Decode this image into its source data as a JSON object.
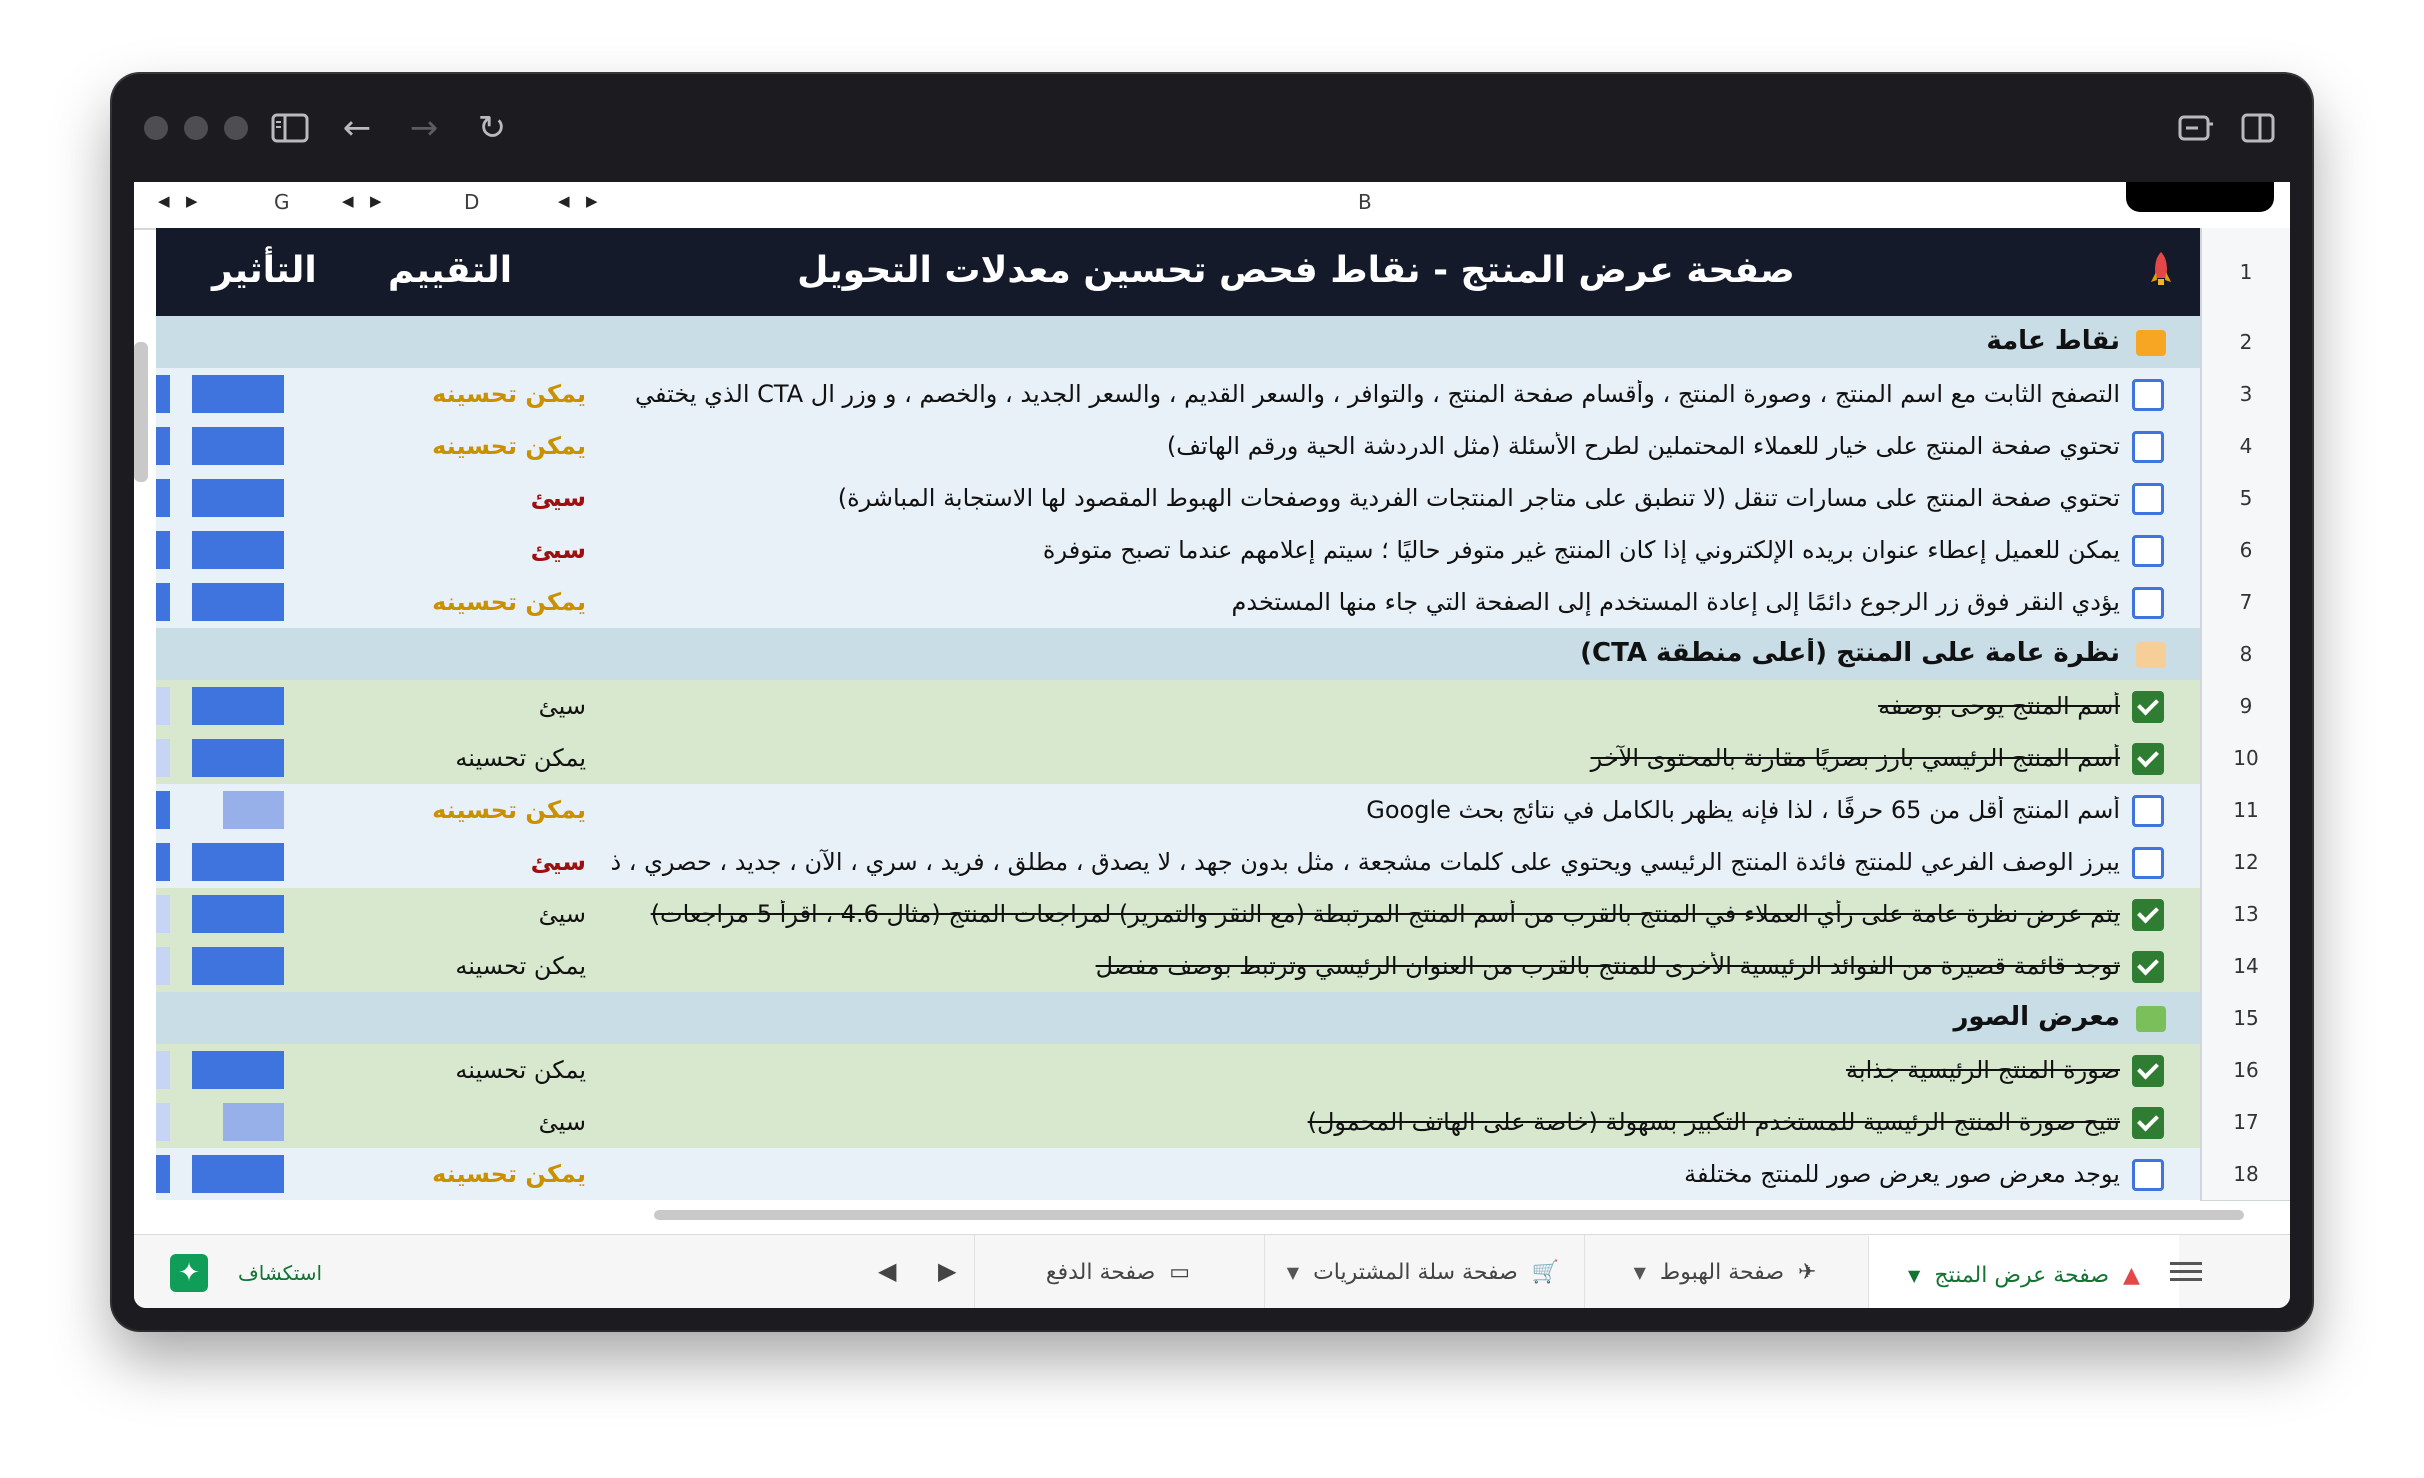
{
  "window": {
    "toolbar": {
      "back": "←",
      "forward": "→",
      "reload": "↻"
    }
  },
  "columns": {
    "g": "G",
    "d": "D",
    "b": "B"
  },
  "sheet": {
    "title": "صفحة عرض المنتج - نقاط فحص تحسين معدلات التحويل",
    "rating_header": "التقييم",
    "impact_header": "التأثير",
    "rows": [
      {
        "num": "1"
      },
      {
        "num": "2",
        "type": "section",
        "text": "نقاط عامة",
        "icon": "sparkle-icon"
      },
      {
        "num": "3",
        "type": "item",
        "checked": false,
        "text": "التصفح الثابت مع اسم المنتج ، وصورة المنتج ، وأقسام صفحة المنتج ، والتوافر ، والسعر القديم ، والسعر الجديد ، والخصم ، و وزر ال CTA الذي يختفي",
        "rating": "يمكن تحسينه",
        "rating_style": "orange",
        "impact": 1.0
      },
      {
        "num": "4",
        "type": "item",
        "checked": false,
        "text": "تحتوي صفحة المنتج على خيار للعملاء المحتملين لطرح الأسئلة (مثل الدردشة الحية ورقم الهاتف)",
        "rating": "يمكن تحسينه",
        "rating_style": "orange",
        "impact": 1.0
      },
      {
        "num": "5",
        "type": "item",
        "checked": false,
        "text": "تحتوي صفحة المنتج على مسارات تنقل (لا تنطبق على متاجر المنتجات الفردية ووصفحات الهبوط المقصود لها الاستجابة المباشرة)",
        "rating": "سيئ",
        "rating_style": "red",
        "impact": 1.0
      },
      {
        "num": "6",
        "type": "item",
        "checked": false,
        "text": "يمكن للعميل إعطاء عنوان بريده الإلكتروني إذا كان المنتج غير متوفر حاليًا ؛ سيتم إعلامهم عندما تصبح متوفرة",
        "rating": "سيئ",
        "rating_style": "red",
        "impact": 1.0
      },
      {
        "num": "7",
        "type": "item",
        "checked": false,
        "text": "يؤدي النقر فوق زر الرجوع دائمًا إلى إعادة المستخدم إلى الصفحة التي جاء منها المستخدم",
        "rating": "يمكن تحسينه",
        "rating_style": "orange",
        "impact": 1.0
      },
      {
        "num": "8",
        "type": "section",
        "text": "نظرة عامة على المنتج (أعلى منطقة CTA)",
        "icon": "tag-icon"
      },
      {
        "num": "9",
        "type": "item",
        "checked": true,
        "text": "أسم المنتج يوحى بوصفه",
        "rating": "سيئ",
        "rating_style": "plain",
        "impact": 1.0
      },
      {
        "num": "10",
        "type": "item",
        "checked": true,
        "text": "أسم المنتج الرئيسي بارز بصريًا مقارنة بالمحتوى الآخر",
        "rating": "يمكن تحسينه",
        "rating_style": "plain",
        "impact": 1.0
      },
      {
        "num": "11",
        "type": "item",
        "checked": false,
        "text": "أسم المنتج أقل من 65 حرفًا ، لذا فإنه يظهر بالكامل في نتائج بحث Google",
        "rating": "يمكن تحسينه",
        "rating_style": "orange",
        "impact": 0.66
      },
      {
        "num": "12",
        "type": "item",
        "checked": false,
        "text": "يبرز الوصف الفرعي للمنتج فائدة المنتج الرئيسي ويحتوي على كلمات مشجعة ، مثل بدون جهد ، لا يصدق ، مطلق ، فريد ، سري ، الآن ، جديد ، حصري ، ذ",
        "rating": "سيئ",
        "rating_style": "red",
        "impact": 1.0
      },
      {
        "num": "13",
        "type": "item",
        "checked": true,
        "text": "يتم عرض نظرة عامة على رأي العملاء في المنتج بالقرب من أسم المنتج المرتبطة (مع النقر والتمرير) لمراجعات المنتج (مثال 4.6 ، اقرأ 5 مراجعات)",
        "rating": "سيئ",
        "rating_style": "plain",
        "impact": 1.0
      },
      {
        "num": "14",
        "type": "item",
        "checked": true,
        "text": "توجد قائمة قصيرة من الفوائد الرئيسية الأخرى للمنتج بالقرب من العنوان الرئيسي وترتبط بوصف مفصل",
        "rating": "يمكن تحسينه",
        "rating_style": "plain",
        "impact": 1.0
      },
      {
        "num": "15",
        "type": "section",
        "text": "معرض الصور",
        "icon": "picture-icon"
      },
      {
        "num": "16",
        "type": "item",
        "checked": true,
        "text": "صورة المنتج الرئيسية جذابة",
        "rating": "يمكن تحسينه",
        "rating_style": "plain",
        "impact": 1.0
      },
      {
        "num": "17",
        "type": "item",
        "checked": true,
        "text": "تتيح صورة المنتج الرئيسية للمستخدم التكبير بسهولة (خاصة على الهاتف المحمول)",
        "rating": "سيئ",
        "rating_style": "plain",
        "impact": 0.66
      },
      {
        "num": "18",
        "type": "item",
        "checked": false,
        "text": "يوجد معرض صور  يعرض صور للمنتج مختلفة",
        "rating": "يمكن تحسينه",
        "rating_style": "orange",
        "impact": 1.0
      }
    ]
  },
  "tabs": [
    {
      "label": "صفحة عرض المنتج",
      "icon": "rocket-icon",
      "active": true
    },
    {
      "label": "صفحة الهبوط",
      "icon": "plane-icon",
      "active": false
    },
    {
      "label": "صفحة سلة المشتريات",
      "icon": "cart-icon",
      "active": false
    },
    {
      "label": "صفحة الدفع",
      "icon": "credit-card-icon",
      "active": false
    }
  ],
  "explore_label": "استكشاف",
  "colors": {
    "title_bg": "#151a2b",
    "section_bg": "#c9dde6",
    "item_bg": "#e9f1f8",
    "checked_bg": "#d7e8cf",
    "impact_blue": "#3f73dd",
    "impact_light": "#98b0ea",
    "orange_rating": "#c99100",
    "red_rating": "#9e0f0f",
    "active_tab": "#137333"
  }
}
